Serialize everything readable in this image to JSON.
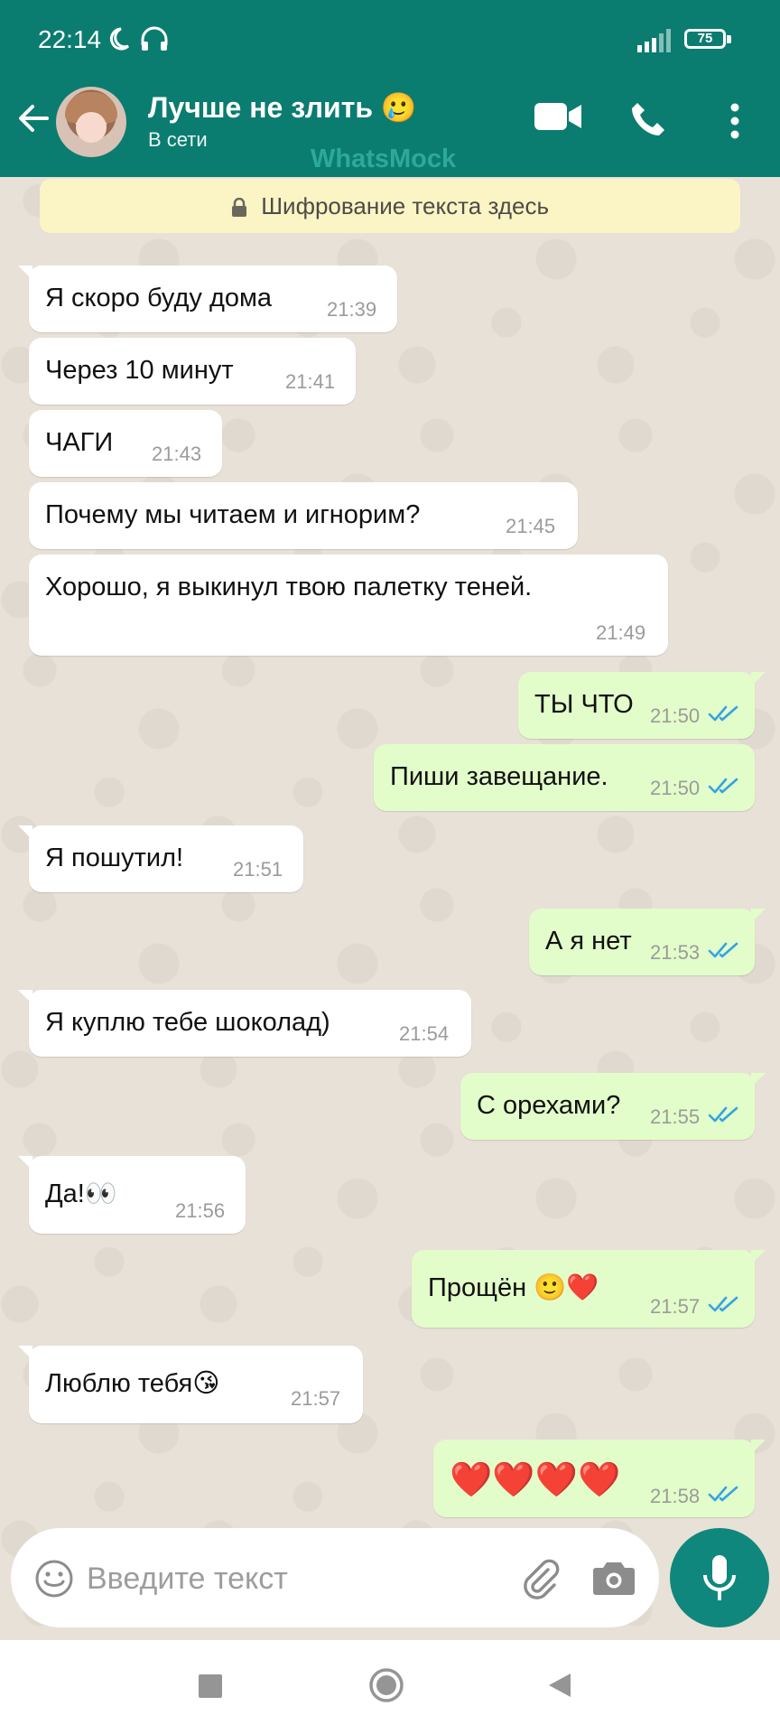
{
  "status_bar": {
    "time": "22:14",
    "battery": "75"
  },
  "header": {
    "contact_name": "Лучше не злить",
    "contact_emoji": "🥲",
    "status": "В сети",
    "watermark": "WhatsMock"
  },
  "encryption_notice": "Шифрование текста здесь",
  "messages": [
    {
      "dir": "in",
      "text": "Я скоро буду дома",
      "time": "21:39"
    },
    {
      "dir": "in",
      "text": "Через 10 минут",
      "time": "21:41"
    },
    {
      "dir": "in",
      "text": "ЧАГИ",
      "time": "21:43"
    },
    {
      "dir": "in",
      "text": "Почему мы читаем и игнорим?",
      "time": "21:45"
    },
    {
      "dir": "in",
      "text": "Хорошо, я выкинул твою палетку теней.",
      "time": "21:49"
    },
    {
      "dir": "out",
      "text": "ТЫ ЧТО",
      "time": "21:50"
    },
    {
      "dir": "out",
      "text": "Пиши завещание.",
      "time": "21:50"
    },
    {
      "dir": "in",
      "text": "Я пошутил!",
      "time": "21:51"
    },
    {
      "dir": "out",
      "text": "А я нет",
      "time": "21:53"
    },
    {
      "dir": "in",
      "text": "Я куплю тебе шоколад)",
      "time": "21:54"
    },
    {
      "dir": "out",
      "text": "С орехами?",
      "time": "21:55"
    },
    {
      "dir": "in",
      "text": "Да!",
      "emoji": "👀",
      "time": "21:56"
    },
    {
      "dir": "out",
      "text": "Прощён",
      "emoji": "🙂❤️",
      "time": "21:57"
    },
    {
      "dir": "in",
      "text": "Люблю тебя",
      "emoji": "😘",
      "time": "21:57"
    },
    {
      "dir": "out",
      "text": "",
      "emoji": "❤️❤️❤️❤️",
      "time": "21:58"
    }
  ],
  "input": {
    "placeholder": "Введите текст"
  },
  "colors": {
    "header": "#0b7c70",
    "incoming_bubble": "#ffffff",
    "outgoing_bubble": "#e2fdc9",
    "mic_button": "#10877c",
    "read_ticks": "#35a2e4"
  }
}
